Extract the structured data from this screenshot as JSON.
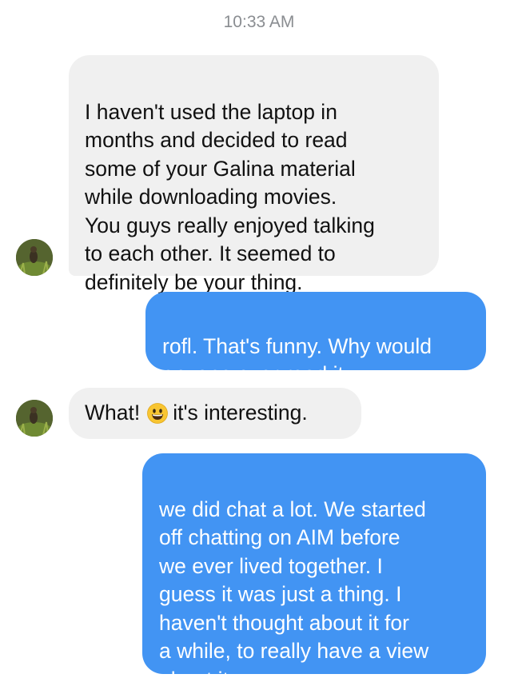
{
  "timestamp": "10:33 AM",
  "messages": [
    {
      "direction": "incoming",
      "text": "I haven't used the laptop in\nmonths and decided to read\nsome of your Galina material\nwhile downloading movies.\nYou guys really enjoyed talking\nto each other. It seemed to\ndefinitely be your thing."
    },
    {
      "direction": "outgoing",
      "text": "rofl. That's funny. Why would\nanyone ever read it."
    },
    {
      "direction": "incoming",
      "text_before_emoji": "What!",
      "emoji": "grinning-face-emoji",
      "text_after_emoji": "it's interesting."
    },
    {
      "direction": "outgoing",
      "text": "we did chat a lot. We started\noff chatting on AIM before\nwe ever lived together. I\nguess it was just a thing. I\nhaven't thought about it for\na while, to really have a view\nabout it."
    }
  ],
  "colors": {
    "incoming_bubble": "#f0f0f0",
    "outgoing_bubble": "#4294f3",
    "timestamp_text": "#8a8d91"
  }
}
